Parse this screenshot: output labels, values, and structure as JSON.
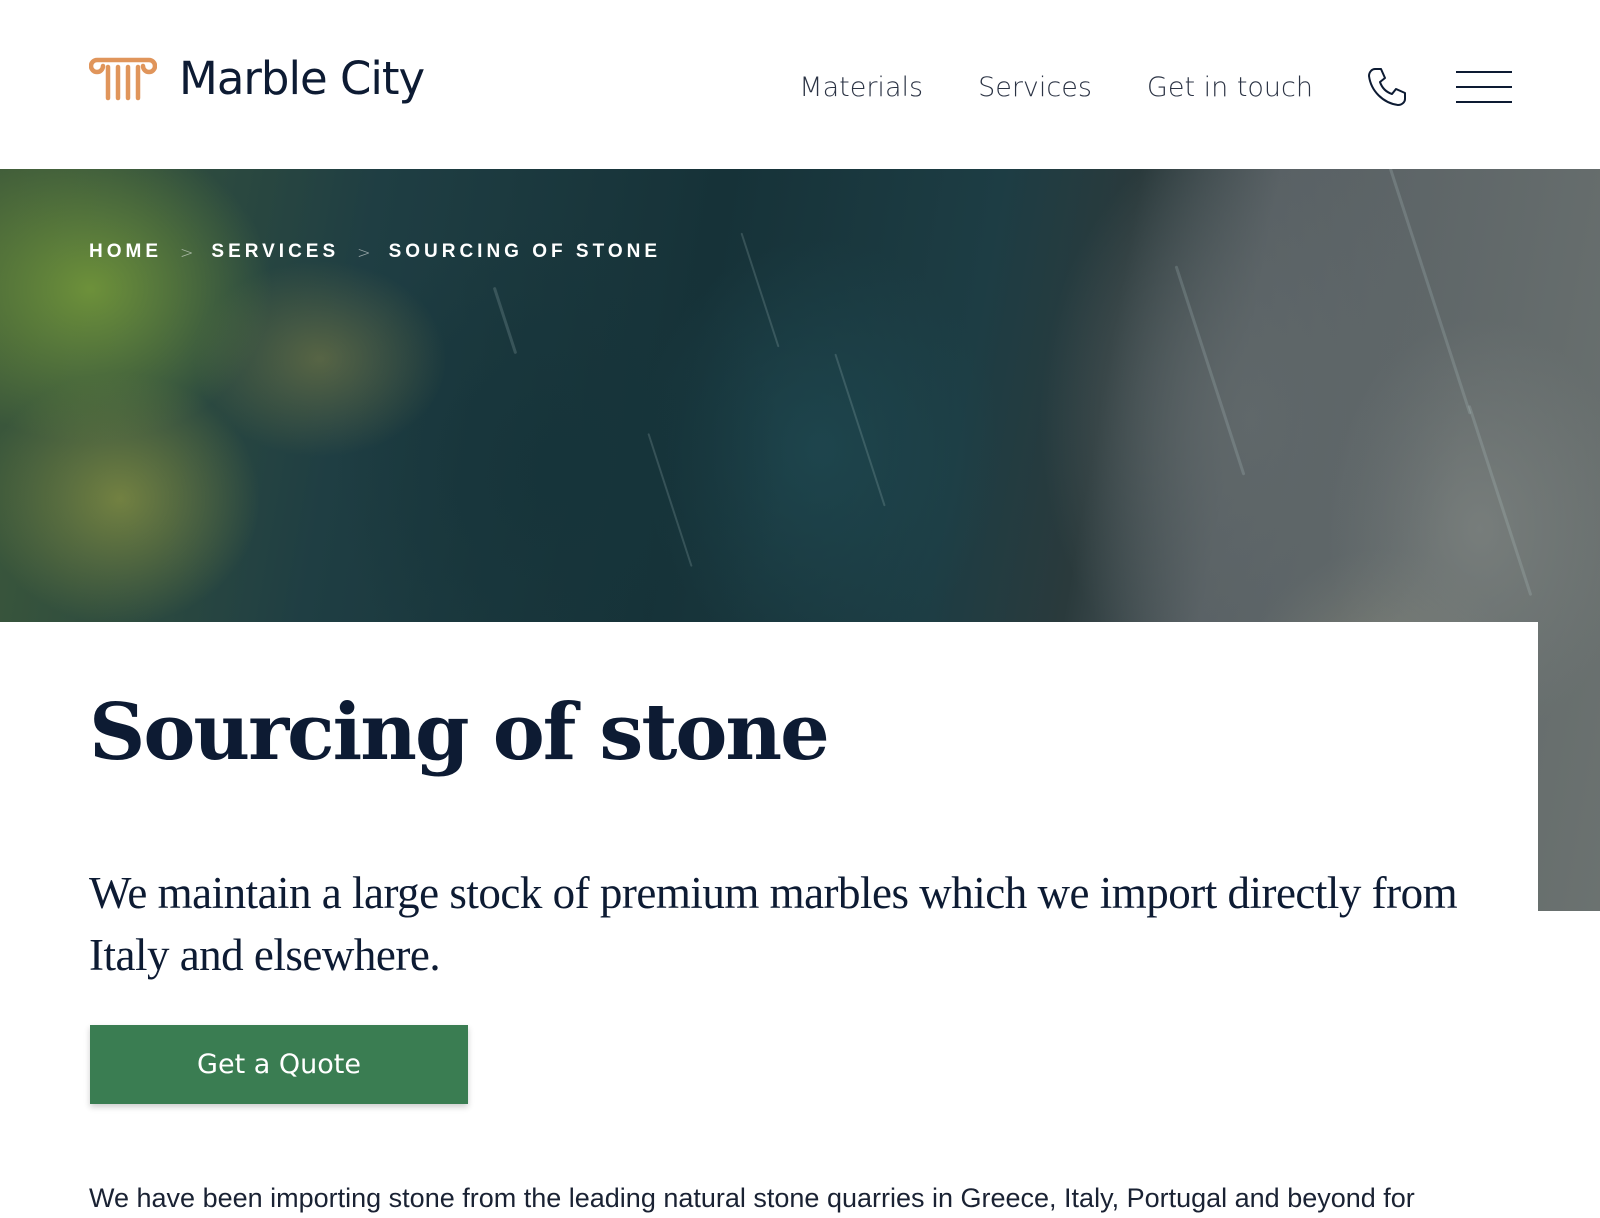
{
  "brand": {
    "name": "Marble City",
    "icon": "ionic-column-icon",
    "accent_color": "#e0955b",
    "text_color": "#0d1b33"
  },
  "nav": {
    "links": [
      "Materials",
      "Services",
      "Get in touch"
    ],
    "phone_icon": "phone-icon",
    "menu_icon": "hamburger-menu-icon"
  },
  "breadcrumb": {
    "items": [
      "HOME",
      "SERVICES",
      "SOURCING OF STONE"
    ],
    "separator": ">"
  },
  "hero": {
    "image": "aerial view of quarry landscape"
  },
  "page": {
    "title": "Sourcing of stone",
    "lead": "We maintain a large stock of premium marbles which we import directly from Italy and elsewhere.",
    "cta_label": "Get a Quote",
    "cta_color": "#3a7d52",
    "body": "We have been importing stone from the leading natural stone quarries in Greece, Italy, Portugal and beyond for"
  }
}
